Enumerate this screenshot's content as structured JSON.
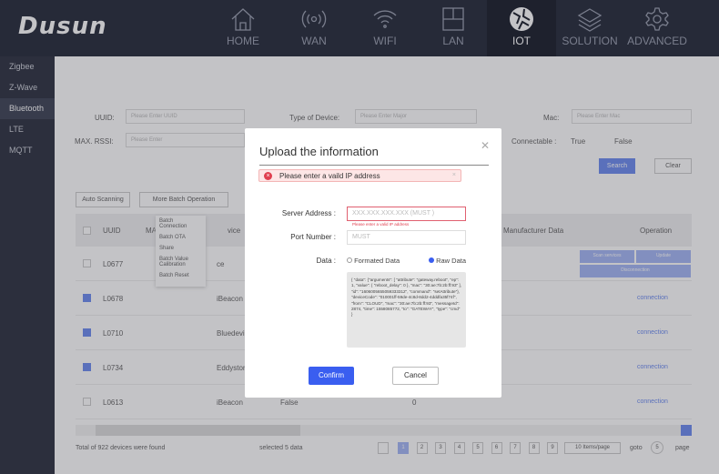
{
  "header": {
    "logo": "Dusun",
    "nav": [
      {
        "label": "HOME",
        "icon": "home-icon"
      },
      {
        "label": "WAN",
        "icon": "broadcast-icon"
      },
      {
        "label": "WIFI",
        "icon": "wifi-icon"
      },
      {
        "label": "LAN",
        "icon": "lan-icon"
      },
      {
        "label": "IOT",
        "icon": "globe-icon",
        "active": true
      },
      {
        "label": "SOLUTION",
        "icon": "layers-icon"
      },
      {
        "label": "ADVANCED",
        "icon": "gear-icon"
      }
    ]
  },
  "sidebar": {
    "items": [
      "Zigbee",
      "Z-Wave",
      "Bluetooth",
      "LTE",
      "MQTT"
    ],
    "active": "Bluetooth"
  },
  "filters": {
    "uuid_label": "UUID:",
    "uuid_placeholder": "Please Enter UUID",
    "type_label": "Type of Device:",
    "type_placeholder": "Please Enter Major",
    "mac_label": "Mac:",
    "mac_placeholder": "Please Enter Mac",
    "rssi_label": "MAX. RSSI:",
    "rssi_placeholder": "Please Enter",
    "connectable_label": "Connectable :",
    "opt_true": "True",
    "opt_false": "False",
    "search": "Search",
    "clear": "Clear"
  },
  "toolbar": {
    "auto_scanning": "Auto Scanning",
    "batch": "More Batch Operation",
    "batch_menu": [
      "Batch Connection",
      "Batch OTA",
      "Share",
      "Batch Value Calibration",
      "Batch Reset"
    ]
  },
  "table": {
    "headers": [
      "UUID",
      "MA",
      "vice",
      "Manufacturer Data",
      "Operation"
    ],
    "rows": [
      {
        "checked": false,
        "uuid": "L0677",
        "type": "ce",
        "c3": "",
        "c5": "",
        "ops": [
          "Scan services",
          "Update",
          "Disconnection"
        ]
      },
      {
        "checked": true,
        "uuid": "L0678",
        "type": "iBeacon",
        "c3": "",
        "c5": "",
        "op": "connection"
      },
      {
        "checked": true,
        "uuid": "L0710",
        "type": "Bluedevice",
        "c3": "",
        "c5": "",
        "op": "connection"
      },
      {
        "checked": true,
        "uuid": "L0734",
        "type": "Eddystone",
        "c3": "",
        "c5": "",
        "op": "connection"
      },
      {
        "checked": false,
        "uuid": "L0613",
        "type": "iBeacon",
        "c3": "False",
        "c5": "0",
        "op": "connection"
      }
    ]
  },
  "footer": {
    "total": "Total of 922 devices  were found",
    "selected": "selected 5 data",
    "pages": [
      "1",
      "2",
      "3",
      "4",
      "5",
      "6",
      "7",
      "8",
      "9"
    ],
    "current_page": "1",
    "per_page": "10 Items/page",
    "goto": "goto",
    "goto_value": "5",
    "page": "page"
  },
  "modal": {
    "title": "Upload the information",
    "alert": "Please enter a vaild IP address",
    "server_label": "Server Address :",
    "server_placeholder": "XXX.XXX.XXX.XXX (MUST )",
    "server_error": "Please enter a valid IP address",
    "port_label": "Port Number :",
    "port_placeholder": "MUST",
    "data_label": "Data :",
    "opt_formatted": "Formated Data",
    "opt_raw": "Raw Data",
    "selected": "Raw Data",
    "raw": "{  \"data\": {\"arguments\": [ \"attribute\": \"gateway.reboot\", \"ep\": 1,  \"value\": {  \"reboot_delay\": 0 }, \"mac\": \"30:ae:7b:2b:ff:93\" ], \"id\": \"1606005655059333312\", \"command\": \"setAttribute\"}, \"deviceCode\": \"010001ff-59de-4c8d-8dd2-4dddfa35f74f\", \"from\": \"CLOUD\", \"mac\": \"30:ae:7b:2b:ff:93\", \"messageId\": 2874, \"time\": 1558085772, \"to\": \"GATEWAY\",     \"type\": \"cmd\"   }",
    "confirm": "Confirm",
    "cancel": "Cancel"
  },
  "colors": {
    "header": "#262b3b",
    "primary": "#3a5ef0",
    "error": "#e04050"
  }
}
